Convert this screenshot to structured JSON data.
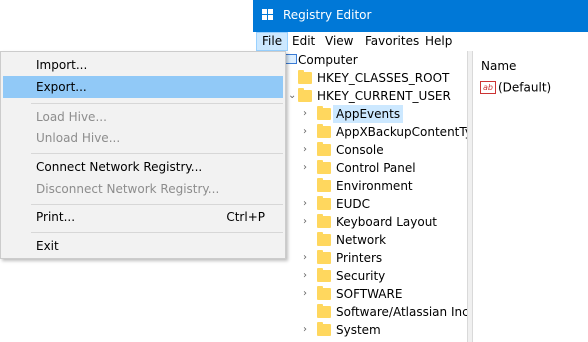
{
  "window": {
    "title": "Registry Editor",
    "menu": [
      "File",
      "Edit",
      "View",
      "Favorites",
      "Help"
    ]
  },
  "file_menu": {
    "import": "Import...",
    "export": "Export...",
    "load_hive": "Load Hive...",
    "unload_hive": "Unload Hive...",
    "connect": "Connect Network Registry...",
    "disconnect": "Disconnect Network Registry...",
    "print": "Print...",
    "print_shortcut": "Ctrl+P",
    "exit": "Exit"
  },
  "tree": {
    "root": "Computer",
    "hives": [
      "HKEY_CLASSES_ROOT",
      "HKEY_CURRENT_USER"
    ],
    "children": [
      "AppEvents",
      "AppXBackupContentTyp",
      "Console",
      "Control Panel",
      "Environment",
      "EUDC",
      "Keyboard Layout",
      "Network",
      "Printers",
      "Security",
      "SOFTWARE",
      "Software/Atlassian Inc/H",
      "System"
    ]
  },
  "values": {
    "column_name": "Name",
    "icon_text": "ab",
    "rows": [
      "(Default)"
    ]
  },
  "colors": {
    "titlebar": "#0078d7",
    "highlight": "#91c9f7",
    "selection": "#cce8ff",
    "folder": "#ffd75e"
  }
}
